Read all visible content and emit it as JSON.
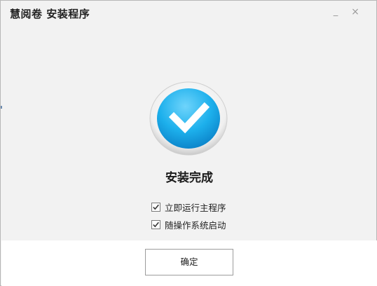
{
  "window": {
    "title": "慧阅卷 安装程序",
    "minimize_glyph": "_",
    "close_glyph": "×"
  },
  "status": {
    "icon": "check-circle-icon",
    "text": "安装完成",
    "accent_color": "#1aa8e8"
  },
  "options": [
    {
      "label": "立即运行主程序",
      "checked": true
    },
    {
      "label": "随操作系统启动",
      "checked": true
    }
  ],
  "footer": {
    "confirm_label": "确定"
  }
}
